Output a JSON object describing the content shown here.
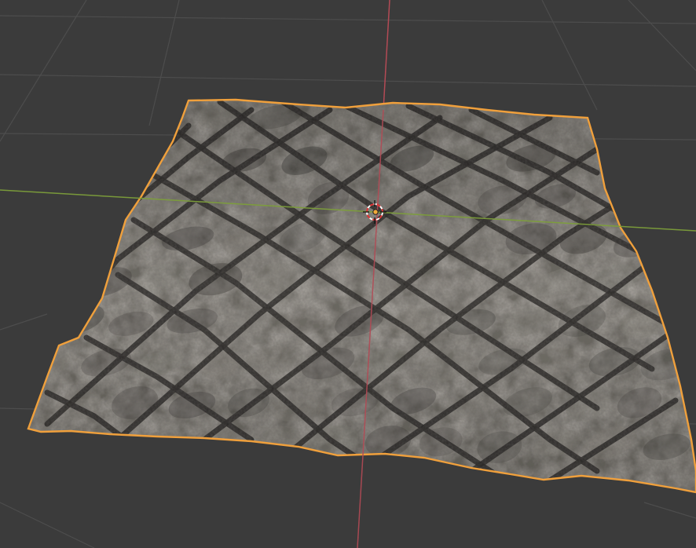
{
  "viewport": {
    "background_color": "#3b3b3b",
    "grid_line_color": "#4c4c4c",
    "x_axis_color": "#7d9f3a",
    "y_axis_color": "#b34a55",
    "selection_outline_color": "#f0a03c",
    "mesh_base_color": "#6d6a63",
    "mesh_dark_color": "#2e2c2a",
    "mesh_light_color": "#8a877f",
    "cursor_icon": "3d-cursor-icon",
    "origin_icon": "object-origin-dot-icon"
  }
}
